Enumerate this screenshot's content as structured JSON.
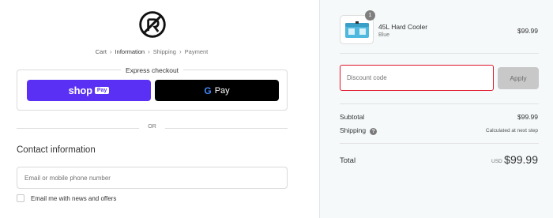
{
  "breadcrumb": {
    "items": [
      "Cart",
      "Information",
      "Shipping",
      "Payment"
    ],
    "active": "Information"
  },
  "express": {
    "title": "Express checkout",
    "shoppay_text": "shop",
    "shoppay_badge": "Pay",
    "gpay_g": "G",
    "gpay_text": "Pay"
  },
  "divider": {
    "or_text": "OR"
  },
  "contact": {
    "title": "Contact information",
    "email_placeholder": "Email or mobile phone number",
    "email_value": "",
    "newsletter_label": "Email me with news and offers"
  },
  "order": {
    "item": {
      "name": "45L Hard Cooler",
      "variant": "Blue",
      "price": "$99.99",
      "quantity": "1"
    },
    "discount_placeholder": "Discount code",
    "apply_label": "Apply",
    "subtotal_label": "Subtotal",
    "subtotal_value": "$99.99",
    "shipping_label": "Shipping",
    "shipping_value": "Calculated at next step",
    "total_label": "Total",
    "total_currency": "USD",
    "total_value": "$99.99"
  },
  "colors": {
    "shoppay": "#5a31f4",
    "gpay": "#000000",
    "discount_border": "#e0162b",
    "apply_bg": "#c8c8c8",
    "sidebar_bg": "#f5f9fa",
    "cooler": "#4fb8df"
  },
  "icons": {
    "logo": "brand-logo-icon",
    "breadcrumb_sep": "chevron-right-icon",
    "help": "question-circle-icon",
    "google": "google-g-icon"
  }
}
